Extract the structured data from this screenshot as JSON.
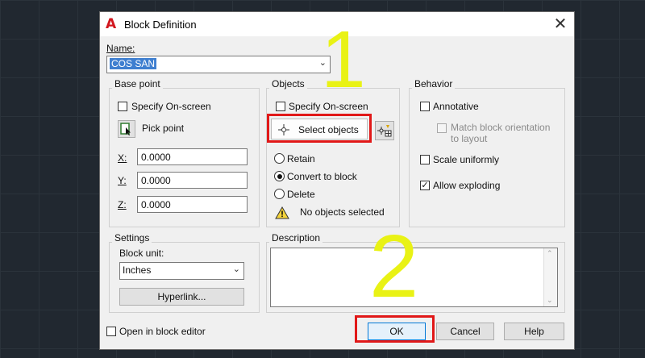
{
  "dialog": {
    "title": "Block Definition",
    "app_icon": "A",
    "close": "✕"
  },
  "name": {
    "label": "Name:",
    "value": "COS SAN"
  },
  "base_point": {
    "title": "Base point",
    "specify_on_screen": "Specify On-screen",
    "pick_point": "Pick point",
    "x_label": "X:",
    "x_value": "0.0000",
    "y_label": "Y:",
    "y_value": "0.0000",
    "z_label": "Z:",
    "z_value": "0.0000"
  },
  "objects": {
    "title": "Objects",
    "specify_on_screen": "Specify On-screen",
    "select_objects": "Select objects",
    "retain": "Retain",
    "convert_to_block": "Convert to block",
    "delete": "Delete",
    "status": "No objects selected"
  },
  "behavior": {
    "title": "Behavior",
    "annotative": "Annotative",
    "match_orientation_line1": "Match block orientation",
    "match_orientation_line2": "to layout",
    "scale_uniformly": "Scale uniformly",
    "allow_exploding": "Allow exploding"
  },
  "settings": {
    "title": "Settings",
    "block_unit_label": "Block unit:",
    "block_unit_value": "Inches",
    "hyperlink": "Hyperlink..."
  },
  "description": {
    "title": "Description"
  },
  "footer": {
    "open_in_block_editor": "Open in block editor",
    "ok": "OK",
    "cancel": "Cancel",
    "help": "Help"
  },
  "annotations": {
    "step1": "1",
    "step2": "2",
    "highlight_color": "#e11818",
    "number_color": "#e9f215"
  }
}
